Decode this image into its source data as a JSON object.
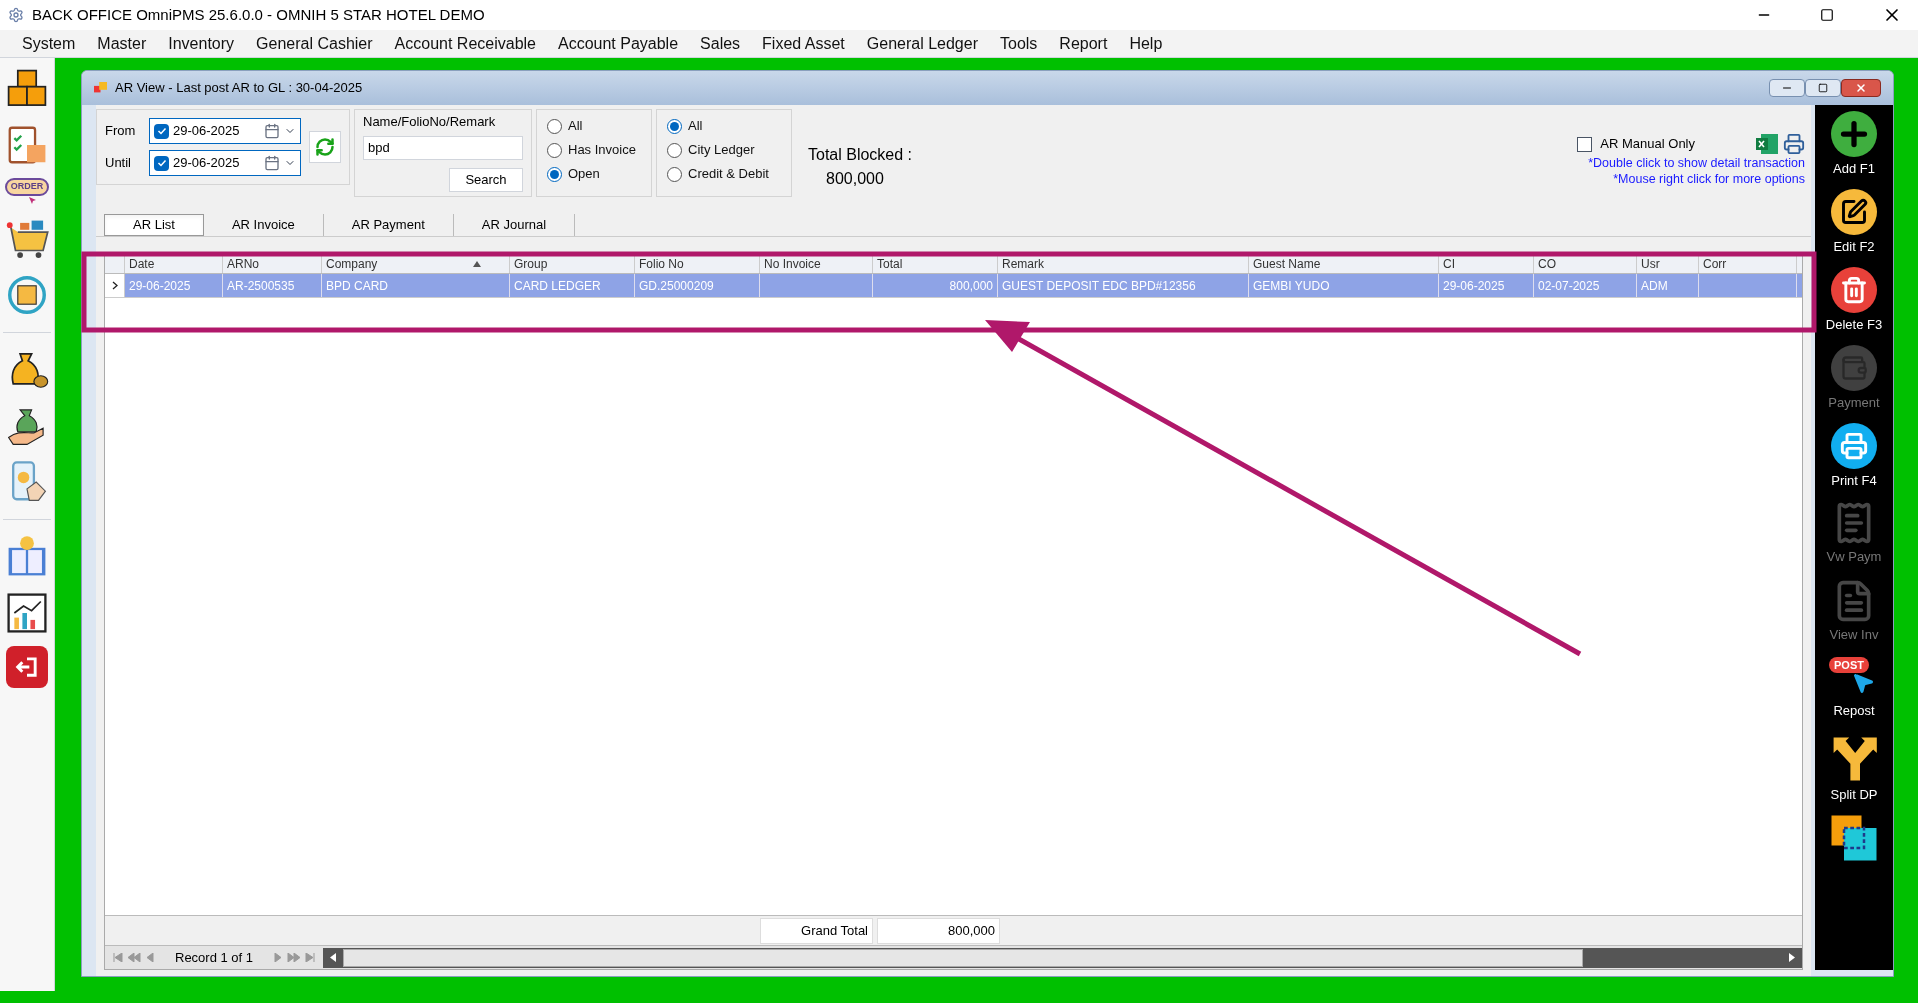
{
  "app_title": "BACK OFFICE OmniPMS 25.6.0.0 - OMNIH 5 STAR HOTEL DEMO",
  "menu": [
    "System",
    "Master",
    "Inventory",
    "General Cashier",
    "Account Receivable",
    "Account Payable",
    "Sales",
    "Fixed Asset",
    "General Ledger",
    "Tools",
    "Report",
    "Help"
  ],
  "sidebar": [
    {
      "kind": "boxes"
    },
    {
      "kind": "clipboard"
    },
    {
      "kind": "order",
      "label": "ORDER"
    },
    {
      "kind": "cart"
    },
    {
      "kind": "cycle"
    },
    {
      "kind": "divider"
    },
    {
      "kind": "moneybag"
    },
    {
      "kind": "hand"
    },
    {
      "kind": "phone"
    },
    {
      "kind": "divider"
    },
    {
      "kind": "book"
    },
    {
      "kind": "chart"
    },
    {
      "kind": "exit"
    }
  ],
  "window": {
    "title": "AR View - Last post AR to GL : 30-04-2025"
  },
  "filters": {
    "from": {
      "label": "From",
      "value": "29-06-2025",
      "checked": true
    },
    "until": {
      "label": "Until",
      "value": "29-06-2025",
      "checked": true
    },
    "search_label": "Name/FolioNo/Remark",
    "search_value": "bpd",
    "search_button": "Search",
    "invoice_options": [
      {
        "label": "All",
        "selected": false
      },
      {
        "label": "Has Invoice",
        "selected": false
      },
      {
        "label": "Open",
        "selected": true
      }
    ],
    "ledger_options": [
      {
        "label": "All",
        "selected": true
      },
      {
        "label": "City Ledger",
        "selected": false
      },
      {
        "label": "Credit & Debit",
        "selected": false
      }
    ],
    "total_blocked_label": "Total Blocked :",
    "total_blocked_value": "800,000",
    "manual_only": {
      "label": "AR Manual Only",
      "checked": false
    },
    "hints": [
      "*Double click to show detail transaction",
      "*Mouse right click for more options"
    ]
  },
  "tabs": [
    {
      "label": "AR List",
      "selected": true
    },
    {
      "label": "AR Invoice",
      "selected": false
    },
    {
      "label": "AR Payment",
      "selected": false
    },
    {
      "label": "AR Journal",
      "selected": false
    }
  ],
  "table": {
    "columns": [
      {
        "label": "Date"
      },
      {
        "label": "ARNo"
      },
      {
        "label": "Company",
        "sorted": true
      },
      {
        "label": "Group"
      },
      {
        "label": "Folio No"
      },
      {
        "label": "No Invoice"
      },
      {
        "label": "Total",
        "kind": "amount"
      },
      {
        "label": "Remark"
      },
      {
        "label": "Guest Name"
      },
      {
        "label": "CI"
      },
      {
        "label": "CO"
      },
      {
        "label": "Usr"
      },
      {
        "label": "Corr"
      }
    ],
    "rows": [
      {
        "selected": true,
        "cells": [
          "29-06-2025",
          "AR-2500535",
          "BPD CARD",
          "CARD LEDGER",
          "GD.25000209",
          "",
          "800,000",
          "GUEST DEPOSIT EDC BPD#12356",
          "GEMBI YUDO",
          "29-06-2025",
          "02-07-2025",
          "ADM",
          ""
        ]
      }
    ]
  },
  "grand_total": {
    "label": "Grand Total",
    "value": "800,000"
  },
  "record": "Record 1 of 1",
  "toolbar": [
    {
      "kind": "add",
      "label": "Add F1",
      "disabled": false
    },
    {
      "kind": "edit",
      "label": "Edit F2",
      "disabled": false
    },
    {
      "kind": "delete",
      "label": "Delete F3",
      "disabled": false
    },
    {
      "kind": "payment",
      "label": "Payment",
      "disabled": true
    },
    {
      "kind": "print",
      "label": "Print F4",
      "disabled": false
    },
    {
      "kind": "receipt",
      "label": "Vw Paym",
      "disabled": true
    },
    {
      "kind": "invoice",
      "label": "View Inv",
      "disabled": true
    },
    {
      "kind": "post",
      "label": "Repost",
      "badge": "POST",
      "disabled": false
    },
    {
      "kind": "split",
      "label": "Split DP",
      "disabled": false
    },
    {
      "kind": "select",
      "disabled": false
    }
  ]
}
